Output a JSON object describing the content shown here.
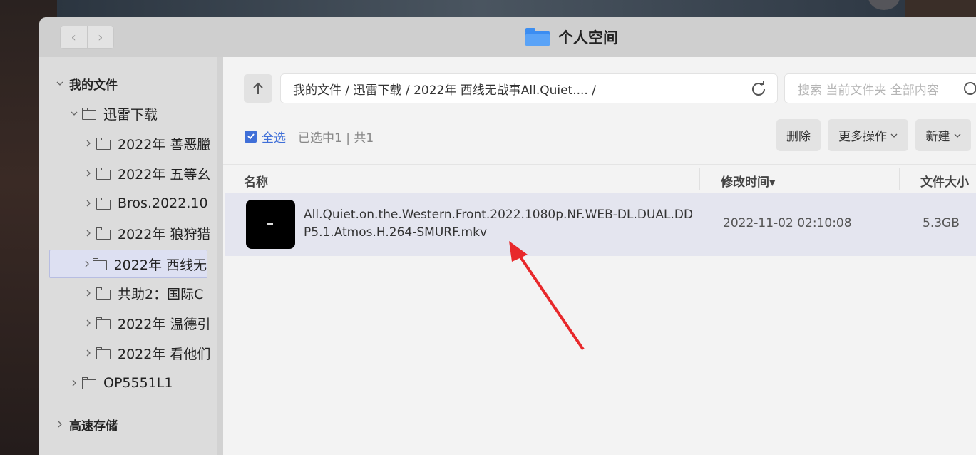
{
  "window": {
    "title": "个人空间"
  },
  "nav": {
    "back_glyph": "‹",
    "forward_glyph": "›"
  },
  "sidebar": {
    "root_label": "我的文件",
    "folder_label": "迅雷下载",
    "subfolders": [
      "2022年 善恶臘",
      "2022年 五等幺",
      "Bros.2022.10",
      "2022年 狼狩猎",
      "2022年 西线无",
      "共助2：国际C",
      "2022年 温德引",
      "2022年 看他们"
    ],
    "selected_index": 4,
    "other_folder": "OP5551L1",
    "storage_label": "高速存储"
  },
  "toolbar": {
    "path": "我的文件 / 迅雷下载 / 2022年 西线无战事All.Quiet.... /",
    "search_placeholder": "搜索 当前文件夹 全部内容",
    "select_all": "全选",
    "selection_info": "已选中1 | 共1",
    "delete_label": "删除",
    "more_label": "更多操作",
    "new_label": "新建"
  },
  "table": {
    "columns": [
      "名称",
      "修改时间",
      "文件大小"
    ],
    "sort_indicator": "▾",
    "rows": [
      {
        "name": "All.Quiet.on.the.Western.Front.2022.1080p.NF.WEB-DL.DUAL.DDP5.1.Atmos.H.264-SMURF.mkv",
        "modified": "2022-11-02 02:10:08",
        "size": "5.3GB"
      }
    ]
  },
  "colors": {
    "accent": "#3f6fd8",
    "annotation_arrow": "#e8282b",
    "selected_row": "#e4e5ef"
  }
}
